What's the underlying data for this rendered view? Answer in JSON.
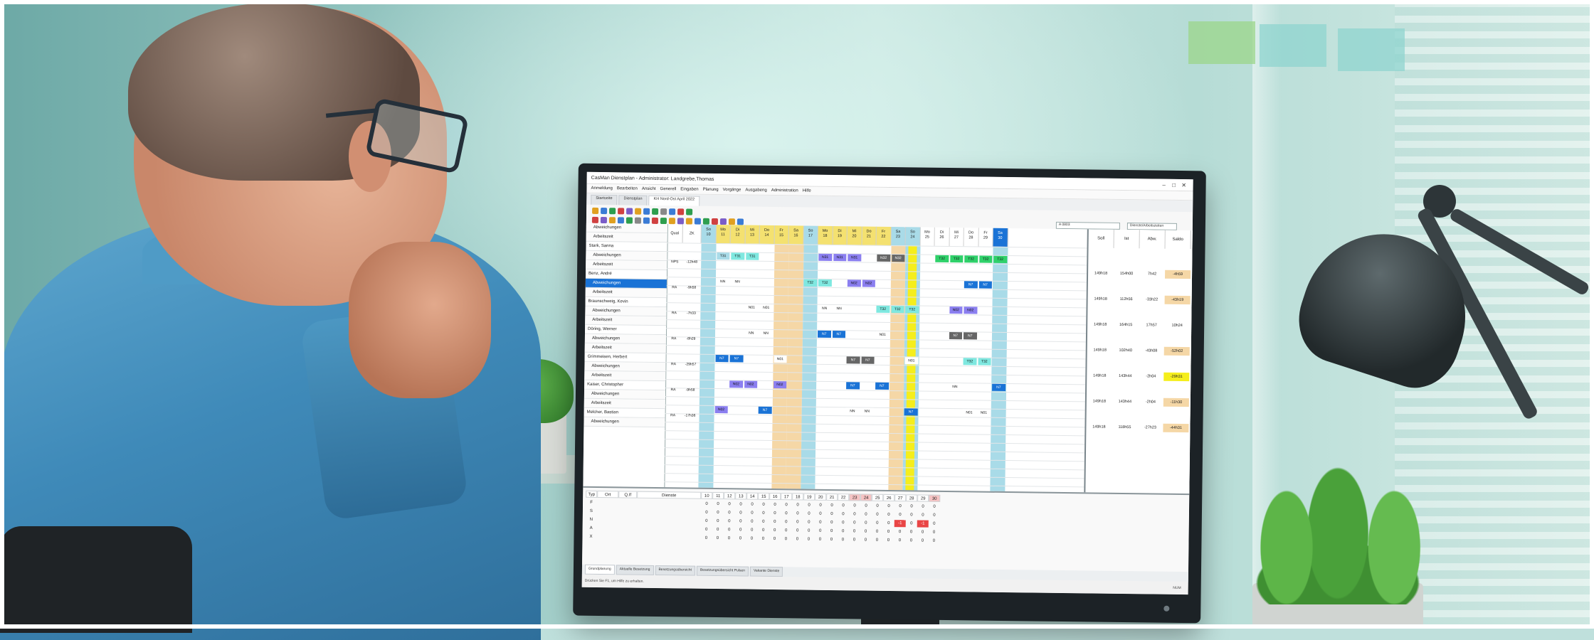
{
  "app": {
    "window_title": "CasMan Dienstplan - Administrator: Landgrebe,Thomas",
    "menu": [
      "Anmeldung",
      "Bearbeiten",
      "Ansicht",
      "Generell",
      "Eingaben",
      "Planung",
      "Vorgänge",
      "Ausgabeng",
      "Administration",
      "Hilfe"
    ],
    "tabs": [
      "Startseite",
      "Dienstplan",
      "KH Nord-Ost April 2022"
    ],
    "unit_select": "A 0803",
    "view_select": "Dienste/Arbeitszeiten",
    "status_text": "Drücken Sie F1, um Hilfe zu erhalten.",
    "status_right": "NUM"
  },
  "grid": {
    "col_qual": "Qual",
    "col_zk": "ZK",
    "days": [
      {
        "wd": "So",
        "d": "10"
      },
      {
        "wd": "Mo",
        "d": "11"
      },
      {
        "wd": "Di",
        "d": "12"
      },
      {
        "wd": "Mi",
        "d": "13"
      },
      {
        "wd": "Do",
        "d": "14"
      },
      {
        "wd": "Fr",
        "d": "15"
      },
      {
        "wd": "Sa",
        "d": "16"
      },
      {
        "wd": "So",
        "d": "17"
      },
      {
        "wd": "Mo",
        "d": "18"
      },
      {
        "wd": "Di",
        "d": "19"
      },
      {
        "wd": "Mi",
        "d": "20"
      },
      {
        "wd": "Do",
        "d": "21"
      },
      {
        "wd": "Fr",
        "d": "22"
      },
      {
        "wd": "Sa",
        "d": "23"
      },
      {
        "wd": "So",
        "d": "24"
      },
      {
        "wd": "Mo",
        "d": "25"
      },
      {
        "wd": "Di",
        "d": "26"
      },
      {
        "wd": "Mi",
        "d": "27"
      },
      {
        "wd": "Do",
        "d": "28"
      },
      {
        "wd": "Fr",
        "d": "29"
      },
      {
        "wd": "Sa",
        "d": "30"
      }
    ],
    "summary_cols": [
      "Soll",
      "Ist",
      "Abw.",
      "Saldo"
    ],
    "people": [
      {
        "name": "Abweichungen",
        "sub": true
      },
      {
        "name": "Arbeitszeit",
        "sub": true
      },
      {
        "name": "Stark, Sanna",
        "sub": false
      },
      {
        "name": "Abweichungen",
        "sub": true
      },
      {
        "name": "Arbeitszeit",
        "sub": true
      },
      {
        "name": "Benz, André",
        "sub": false
      },
      {
        "name": "Abweichungen",
        "sub": true,
        "selected": true
      },
      {
        "name": "Arbeitszeit",
        "sub": true
      },
      {
        "name": "Braunschweig, Kevin",
        "sub": false
      },
      {
        "name": "Abweichungen",
        "sub": true
      },
      {
        "name": "Arbeitszeit",
        "sub": true
      },
      {
        "name": "Döring, Werner",
        "sub": false
      },
      {
        "name": "Abweichungen",
        "sub": true
      },
      {
        "name": "Arbeitszeit",
        "sub": true
      },
      {
        "name": "Grimmeisen, Herbert",
        "sub": false
      },
      {
        "name": "Abweichungen",
        "sub": true
      },
      {
        "name": "Arbeitszeit",
        "sub": true
      },
      {
        "name": "Kaiser, Christopher",
        "sub": false
      },
      {
        "name": "Abweichungen",
        "sub": true
      },
      {
        "name": "Arbeitszeit",
        "sub": true
      },
      {
        "name": "Melcher, Bastian",
        "sub": false
      },
      {
        "name": "Abweichungen",
        "sub": true
      }
    ],
    "rows": [
      {
        "qual": "NPS",
        "zk": "-12h48",
        "soll": "149h18",
        "ist": "154h00",
        "abw": "7h42",
        "saldo": "-4h59"
      },
      {
        "qual": "RA",
        "zk": "-9h58",
        "soll": "149h18",
        "ist": "112h56",
        "abw": "-33h22",
        "saldo": "-43h19"
      },
      {
        "qual": "RA",
        "zk": "-7h33",
        "soll": "149h18",
        "ist": "164h15",
        "abw": "17h57",
        "saldo": "10h24"
      },
      {
        "qual": "RA",
        "zk": "-8h29",
        "soll": "149h18",
        "ist": "102h40",
        "abw": "-43h08",
        "saldo": "-52h02"
      },
      {
        "qual": "RA",
        "zk": "-29h57",
        "soll": "149h18",
        "ist": "143h44",
        "abw": "-2h04",
        "saldo": "-29h31"
      },
      {
        "qual": "RA",
        "zk": "-9h58",
        "soll": "149h18",
        "ist": "143h44",
        "abw": "-2h04",
        "saldo": "-11h30"
      },
      {
        "qual": "RA",
        "zk": "-17h36",
        "soll": "149h18",
        "ist": "118h55",
        "abw": "-27h23",
        "saldo": "-44h31"
      }
    ],
    "codes": [
      "T32",
      "N32",
      "N31",
      "N7",
      "T31",
      "NN",
      "N01",
      "N02",
      "NVB",
      "B7"
    ]
  },
  "bottom": {
    "headers": [
      "Typ",
      "Ort",
      "Q.If",
      "Dienste"
    ],
    "days": [
      "10",
      "11",
      "12",
      "13",
      "14",
      "15",
      "16",
      "17",
      "18",
      "19",
      "20",
      "21",
      "22",
      "23",
      "24",
      "25",
      "26",
      "27",
      "28",
      "29",
      "30"
    ],
    "types": [
      "F",
      "S",
      "N",
      "A",
      "X"
    ],
    "neg_value": "-1",
    "tabs": [
      "Grundplanung",
      "Aktuelle Besetzung",
      "Besetzungsübersicht",
      "Besetzungsübersicht Pulsen",
      "Vakante Dienste"
    ]
  }
}
